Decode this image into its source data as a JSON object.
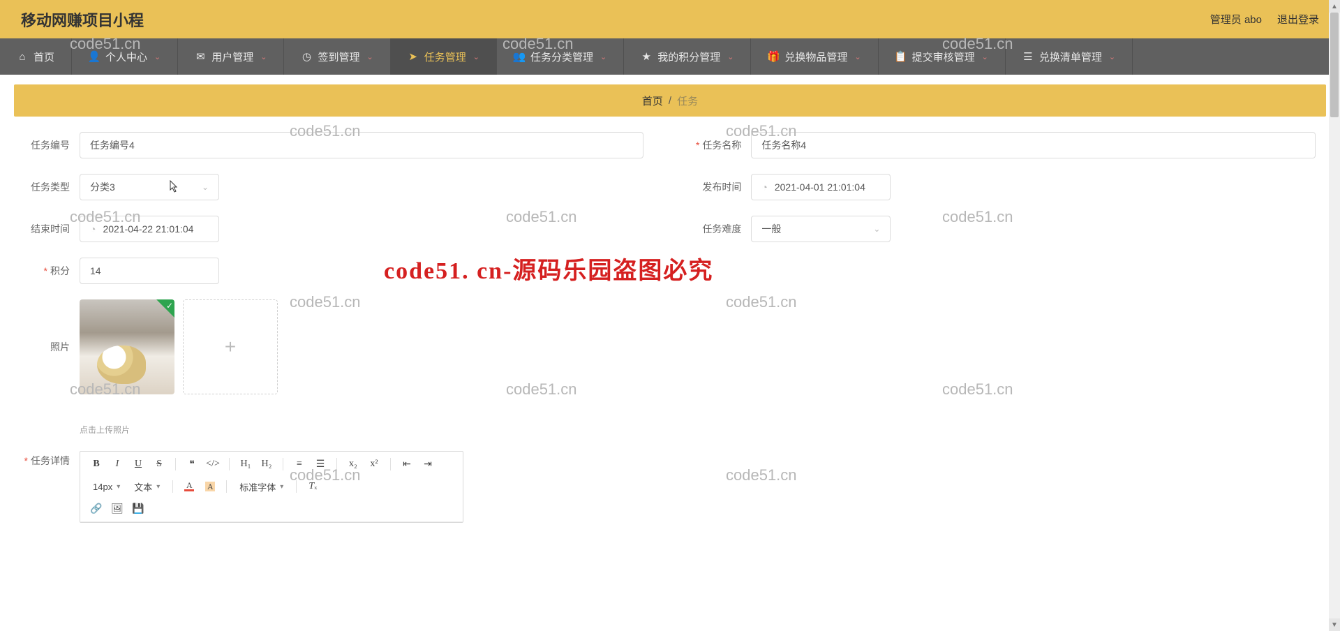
{
  "app_title": "移动网赚项目小程",
  "top_right": {
    "admin": "管理员 abo",
    "logout": "退出登录"
  },
  "nav": [
    {
      "icon": "home",
      "label": "首页",
      "chev": false
    },
    {
      "icon": "user",
      "label": "个人中心",
      "chev": true
    },
    {
      "icon": "mail",
      "label": "用户管理",
      "chev": true
    },
    {
      "icon": "clock",
      "label": "签到管理",
      "chev": true
    },
    {
      "icon": "send",
      "label": "任务管理",
      "chev": true,
      "active": true
    },
    {
      "icon": "users",
      "label": "任务分类管理",
      "chev": true
    },
    {
      "icon": "star",
      "label": "我的积分管理",
      "chev": true
    },
    {
      "icon": "gift",
      "label": "兑换物品管理",
      "chev": true
    },
    {
      "icon": "clipboard",
      "label": "提交审核管理",
      "chev": true
    },
    {
      "icon": "list",
      "label": "兑换清单管理",
      "chev": true
    }
  ],
  "breadcrumb": {
    "home": "首页",
    "sep": "/",
    "cur": "任务"
  },
  "form": {
    "task_no_label": "任务编号",
    "task_no_value": "任务编号4",
    "task_name_label": "任务名称",
    "task_name_value": "任务名称4",
    "task_type_label": "任务类型",
    "task_type_value": "分类3",
    "pub_time_label": "发布时间",
    "pub_time_value": "2021-04-01 21:01:04",
    "end_time_label": "结束时间",
    "end_time_value": "2021-04-22 21:01:04",
    "difficulty_label": "任务难度",
    "difficulty_value": "一般",
    "points_label": "积分",
    "points_value": "14",
    "photo_label": "照片",
    "photo_hint": "点击上传照片",
    "detail_label": "任务详情"
  },
  "editor_toolbar": {
    "size": "14px",
    "block": "文本",
    "font": "标准字体"
  },
  "watermarks": [
    "code51.cn"
  ],
  "watermark_red": "code51. cn-源码乐园盗图必究"
}
